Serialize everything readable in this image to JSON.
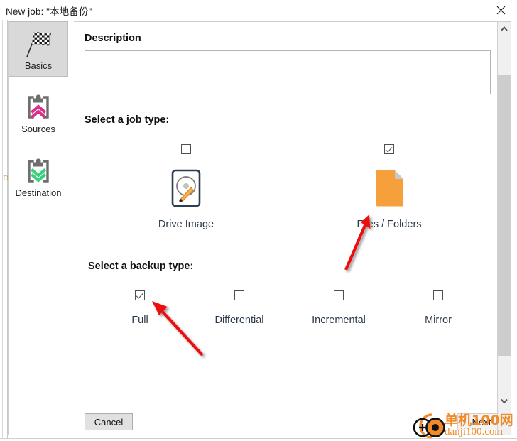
{
  "window": {
    "title": "New job: \"本地备份\"",
    "close_icon": "close-icon"
  },
  "sidebar": {
    "items": [
      {
        "label": "Basics",
        "icon": "checkered-flag-icon",
        "selected": true
      },
      {
        "label": "Sources",
        "icon": "clipboard-up-arrows-icon",
        "selected": false
      },
      {
        "label": "Destination",
        "icon": "clipboard-down-arrows-icon",
        "selected": false
      }
    ]
  },
  "main": {
    "description": {
      "title": "Description",
      "value": "",
      "placeholder": ""
    },
    "job_type": {
      "title": "Select a job type:",
      "options": [
        {
          "label": "Drive Image",
          "icon": "hard-drive-icon",
          "checked": false
        },
        {
          "label": "Files / Folders",
          "icon": "document-file-icon",
          "checked": true
        }
      ]
    },
    "backup_type": {
      "title": "Select a backup type:",
      "options": [
        {
          "label": "Full",
          "checked": true
        },
        {
          "label": "Differential",
          "checked": false
        },
        {
          "label": "Incremental",
          "checked": false
        },
        {
          "label": "Mirror",
          "checked": false
        }
      ]
    }
  },
  "footer": {
    "cancel_label": "Cancel",
    "next_label": "Next"
  },
  "scrollbar": {
    "up_icon": "chevron-up-icon",
    "down_icon": "chevron-down-icon"
  },
  "watermark": {
    "text_cn": "单机100网",
    "text_url": "danji100.com",
    "color": "#f08a2a"
  },
  "annotations": {
    "arrow_color": "#ee1111",
    "arrows": [
      {
        "name": "arrow-to-files-folders",
        "points_to": "Files / Folders"
      },
      {
        "name": "arrow-to-full-checkbox",
        "points_to": "Full"
      }
    ]
  },
  "colors": {
    "selected_tab_bg": "#d9d9d9",
    "sources_accent": "#d8308a",
    "destination_accent": "#3dd17f",
    "drive_icon_outline": "#2c3e50",
    "drive_icon_accent": "#f0a030",
    "file_icon": "#f6a03c"
  }
}
